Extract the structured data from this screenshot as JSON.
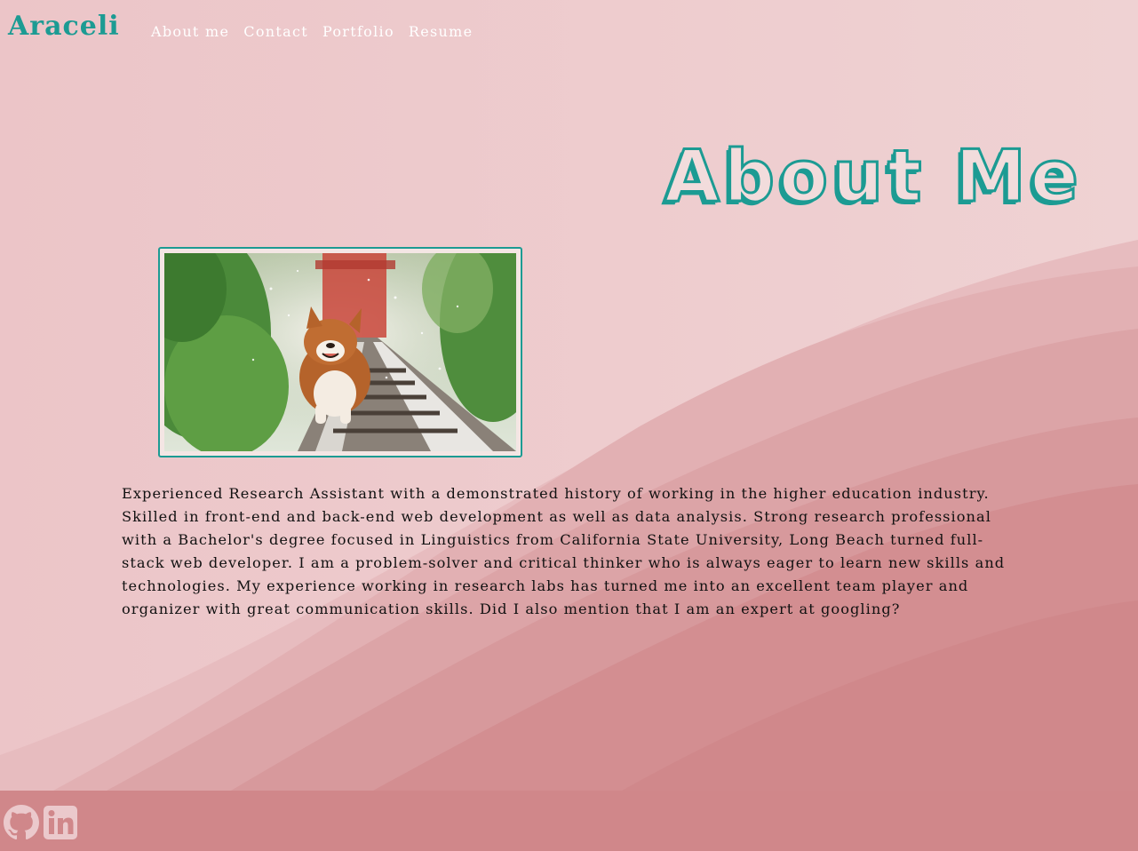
{
  "brand": "Araceli",
  "nav": [
    {
      "label": "About me"
    },
    {
      "label": "Contact"
    },
    {
      "label": "Portfolio"
    },
    {
      "label": "Resume"
    }
  ],
  "hero": {
    "title": "About Me"
  },
  "photo": {
    "alt": "Corgi running along railway tracks"
  },
  "bio": "Experienced Research Assistant with a demonstrated history of working in the higher education industry. Skilled in front-end and back-end web development as well as data analysis. Strong research professional with a Bachelor's degree focused in Linguistics from California State University, Long Beach turned full-stack web developer. I am a problem-solver and critical thinker who is always eager to learn new skills and technologies. My experience working in research labs has turned me into an excellent team player and organizer with great communication skills. Did I also mention that I am an expert at googling?",
  "footer": {
    "icons": [
      "github-icon",
      "linkedin-icon"
    ]
  },
  "colors": {
    "accent": "#1c9b93",
    "background": "#ebc9cc",
    "footer": "#d0878a"
  }
}
